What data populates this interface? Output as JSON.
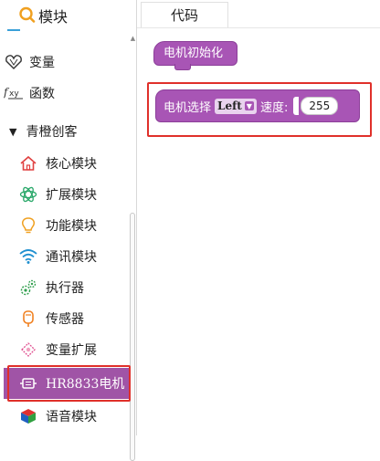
{
  "sidebar": {
    "header": {
      "label": "模块"
    },
    "items": [
      {
        "label": "变量",
        "icon": "heart-outline-icon"
      },
      {
        "label": "函数",
        "icon": "function-xy-icon"
      },
      {
        "label": "青橙创客",
        "icon": "triangle-down-icon"
      },
      {
        "label": "核心模块",
        "icon": "house-icon"
      },
      {
        "label": "扩展模块",
        "icon": "atom-icon"
      },
      {
        "label": "功能模块",
        "icon": "lightbulb-icon"
      },
      {
        "label": "通讯模块",
        "icon": "wifi-icon"
      },
      {
        "label": "执行器",
        "icon": "gears-icon"
      },
      {
        "label": "传感器",
        "icon": "sensor-icon"
      },
      {
        "label": "变量扩展",
        "icon": "puzzle-icon"
      },
      {
        "label": "HR8833电机",
        "icon": "motor-icon"
      },
      {
        "label": "语音模块",
        "icon": "cube-icon"
      }
    ],
    "colors": {
      "selected_bg": "#a054a6"
    }
  },
  "workspace": {
    "tab_label": "代码",
    "init_block": {
      "label": "电机初始化"
    },
    "motor_block": {
      "label": "电机选择",
      "dropdown_value": "Left",
      "speed_label": "速度:",
      "speed_value": "255"
    },
    "colors": {
      "block": "#a855b5",
      "highlight": "#e0302a"
    }
  }
}
